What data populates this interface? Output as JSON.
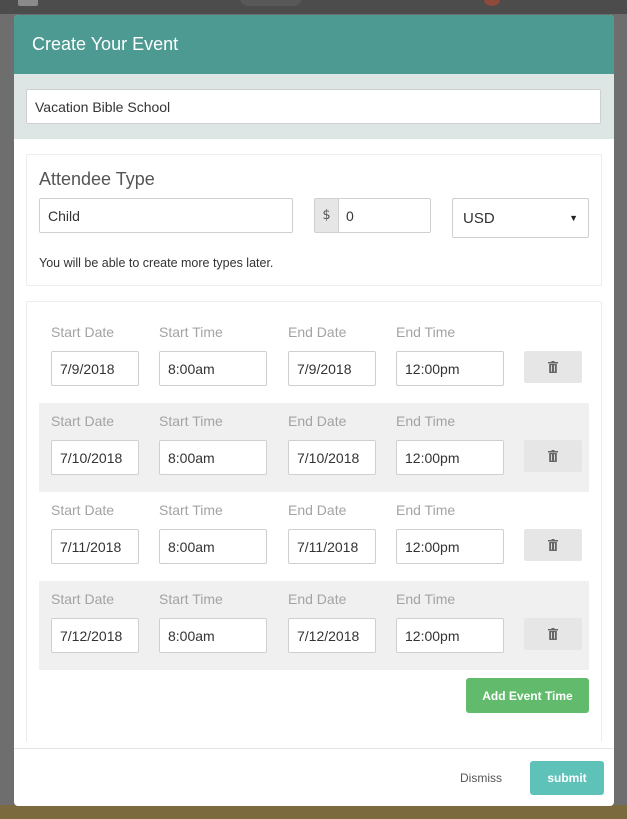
{
  "modal": {
    "title": "Create Your Event",
    "event_name": "Vacation Bible School",
    "header_color": "#4d9a93"
  },
  "attendee": {
    "heading": "Attendee Type",
    "type_value": "Child",
    "currency_symbol": "$",
    "price_value": "0",
    "currency_selected": "USD",
    "note": "You will be able to create more types later."
  },
  "times": {
    "labels": {
      "start_date": "Start Date",
      "start_time": "Start Time",
      "end_date": "End Date",
      "end_time": "End Time"
    },
    "rows": [
      {
        "start_date": "7/9/2018",
        "start_time": "8:00am",
        "end_date": "7/9/2018",
        "end_time": "12:00pm"
      },
      {
        "start_date": "7/10/2018",
        "start_time": "8:00am",
        "end_date": "7/10/2018",
        "end_time": "12:00pm"
      },
      {
        "start_date": "7/11/2018",
        "start_time": "8:00am",
        "end_date": "7/11/2018",
        "end_time": "12:00pm"
      },
      {
        "start_date": "7/12/2018",
        "start_time": "8:00am",
        "end_date": "7/12/2018",
        "end_time": "12:00pm"
      }
    ],
    "add_label": "Add Event Time",
    "delete_icon": "trash-icon"
  },
  "footer": {
    "dismiss_label": "Dismiss",
    "submit_label": "submit"
  },
  "colors": {
    "add_button": "#62bb6c",
    "submit_button": "#5ec2b8"
  }
}
